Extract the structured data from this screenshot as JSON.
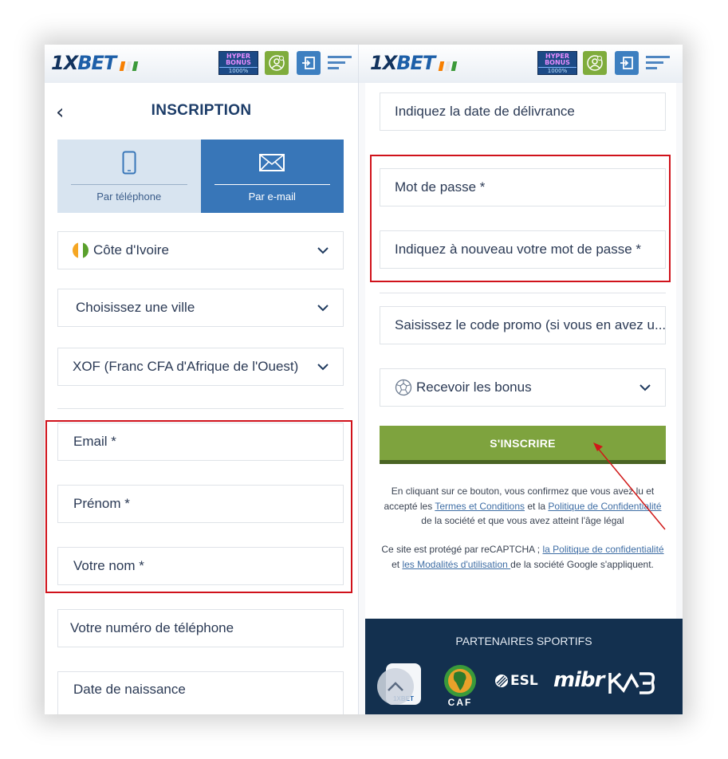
{
  "brand": {
    "logo_prefix": "1X",
    "logo_suffix": "BET",
    "flag_colors": [
      "#f77f00",
      "#ffffff",
      "#009e60"
    ],
    "hyper_bonus": {
      "line1": "HYPER",
      "line2": "BONUS",
      "line3": "1000%"
    }
  },
  "left": {
    "title": "INSCRIPTION",
    "back_icon": "chevron-left-icon",
    "tabs": [
      {
        "label": "Par téléphone",
        "icon": "phone-icon",
        "active": false
      },
      {
        "label": "Par e-mail",
        "icon": "envelope-icon",
        "active": true
      }
    ],
    "country_select": {
      "value": "Côte d'Ivoire"
    },
    "city_select": {
      "value": "Choisissez une ville"
    },
    "currency_select": {
      "value": "XOF (Franc CFA d'Afrique de l'Ouest)"
    },
    "fields": {
      "email": "Email  *",
      "first_name": "Prénom  *",
      "last_name": "Votre nom  *",
      "phone": "Votre numéro de téléphone",
      "birth_date": "Date de naissance"
    }
  },
  "right": {
    "fields": {
      "issue_date": "Indiquez la date de délivrance",
      "password": "Mot de passe  *",
      "password_repeat": "Indiquez à nouveau votre mot de passe  *",
      "promo_code": "Saisissez le code promo (si vous en avez u..."
    },
    "bonus_select": {
      "value": "Recevoir les bonus",
      "icon": "soccer-ball-icon"
    },
    "register_button": "S'INSCRIRE",
    "legal1": {
      "pre": "En cliquant sur ce bouton, vous confirmez que vous avez lu et accepté les ",
      "link1": "Termes et Conditions",
      "mid": " et la ",
      "link2": "Politique de Confidentialité",
      "post": " de la société et que vous avez atteint l'âge légal"
    },
    "legal2": {
      "pre": "Ce site est protégé par reCAPTCHA ; ",
      "link1": "la Politique de confidentialité",
      "mid": " et ",
      "link2": "les Modalités d'utilisation ",
      "post": "de la société Google s'appliquent."
    },
    "partners": {
      "title": "PARTENAIRES SPORTIFS",
      "logos": [
        "1XBET",
        "CAF",
        "ESL",
        "mibr",
        "KDB"
      ]
    }
  },
  "colors": {
    "accent_blue": "#3876b8",
    "register_green": "#7ea33e",
    "highlight_red": "#d0121b",
    "partners_bg": "#13304f"
  }
}
